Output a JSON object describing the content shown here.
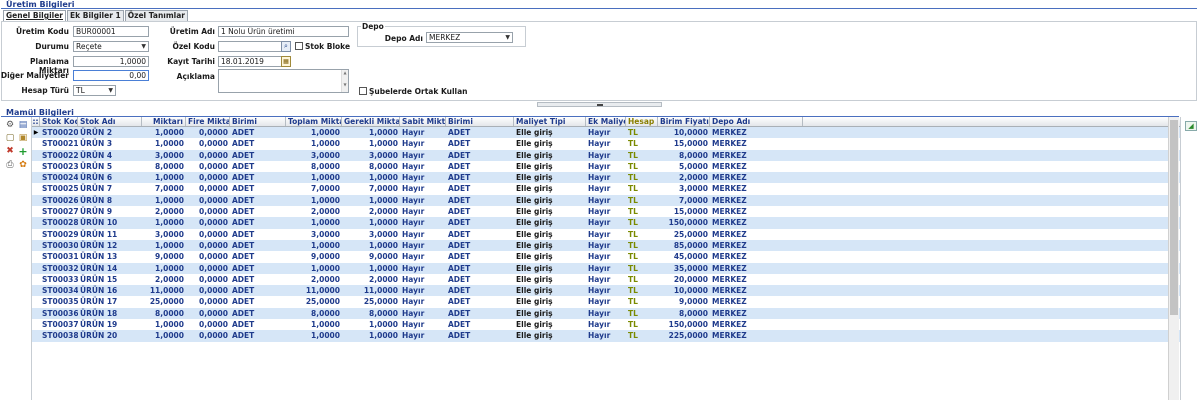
{
  "section_uretim": "Üretim Bilgileri",
  "tabs": [
    {
      "label": "Genel Bilgiler",
      "active": true
    },
    {
      "label": "Ek Bilgiler 1",
      "active": false
    },
    {
      "label": "Özel Tanımlar",
      "active": false
    }
  ],
  "form": {
    "uretim_kodu_label": "Üretim Kodu",
    "uretim_kodu": "BUR00001",
    "durumu_label": "Durumu",
    "durumu": "Reçete",
    "planlama_label": "Planlama Miktarı",
    "planlama": "1,0000",
    "diger_label": "Diğer Maliyetler",
    "diger": "0,00",
    "hesap_turu_label": "Hesap Türü",
    "hesap_turu": "TL",
    "uretim_adi_label": "Üretim Adı",
    "uretim_adi": "1 Nolu Ürün üretimi",
    "ozel_kodu_label": "Özel Kodu",
    "ozel_kodu": "",
    "stok_bloke_label": "Stok Bloke",
    "kayit_tarihi_label": "Kayıt Tarihi",
    "kayit_tarihi": "18.01.2019",
    "aciklama_label": "Açıklama",
    "aciklama": "",
    "depo_group_label": "Depo",
    "depo_adi_label": "Depo Adı",
    "depo_adi": "MERKEZ",
    "subeler_label": "Şubelerde Ortak Kullan"
  },
  "section_mamul": "Mamül Bilgileri",
  "grid": {
    "columns": [
      "Stok Kodu",
      "Stok Adı",
      "Miktarı",
      "Fire Miktarı",
      "Birimi",
      "Toplam Miktar",
      "Gerekli Miktar",
      "Sabit Miktar",
      "Birimi",
      "Maliyet Tipi",
      "Ek Maliyet",
      "Hesap",
      "Birim Fiyatı",
      "Depo Adı"
    ],
    "rows": [
      [
        "ST00020",
        "ÜRÜN 2",
        "1,0000",
        "0,0000",
        "ADET",
        "1,0000",
        "1,0000",
        "Hayır",
        "ADET",
        "Elle giriş",
        "Hayır",
        "TL",
        "10,0000",
        "MERKEZ"
      ],
      [
        "ST00021",
        "ÜRÜN 3",
        "1,0000",
        "0,0000",
        "ADET",
        "1,0000",
        "1,0000",
        "Hayır",
        "ADET",
        "Elle giriş",
        "Hayır",
        "TL",
        "15,0000",
        "MERKEZ"
      ],
      [
        "ST00022",
        "ÜRÜN 4",
        "3,0000",
        "0,0000",
        "ADET",
        "3,0000",
        "3,0000",
        "Hayır",
        "ADET",
        "Elle giriş",
        "Hayır",
        "TL",
        "8,0000",
        "MERKEZ"
      ],
      [
        "ST00023",
        "ÜRÜN 5",
        "8,0000",
        "0,0000",
        "ADET",
        "8,0000",
        "8,0000",
        "Hayır",
        "ADET",
        "Elle giriş",
        "Hayır",
        "TL",
        "5,0000",
        "MERKEZ"
      ],
      [
        "ST00024",
        "ÜRÜN 6",
        "1,0000",
        "0,0000",
        "ADET",
        "1,0000",
        "1,0000",
        "Hayır",
        "ADET",
        "Elle giriş",
        "Hayır",
        "TL",
        "2,0000",
        "MERKEZ"
      ],
      [
        "ST00025",
        "ÜRÜN 7",
        "7,0000",
        "0,0000",
        "ADET",
        "7,0000",
        "7,0000",
        "Hayır",
        "ADET",
        "Elle giriş",
        "Hayır",
        "TL",
        "3,0000",
        "MERKEZ"
      ],
      [
        "ST00026",
        "ÜRÜN 8",
        "1,0000",
        "0,0000",
        "ADET",
        "1,0000",
        "1,0000",
        "Hayır",
        "ADET",
        "Elle giriş",
        "Hayır",
        "TL",
        "7,0000",
        "MERKEZ"
      ],
      [
        "ST00027",
        "ÜRÜN 9",
        "2,0000",
        "0,0000",
        "ADET",
        "2,0000",
        "2,0000",
        "Hayır",
        "ADET",
        "Elle giriş",
        "Hayır",
        "TL",
        "15,0000",
        "MERKEZ"
      ],
      [
        "ST00028",
        "ÜRÜN 10",
        "1,0000",
        "0,0000",
        "ADET",
        "1,0000",
        "1,0000",
        "Hayır",
        "ADET",
        "Elle giriş",
        "Hayır",
        "TL",
        "150,0000",
        "MERKEZ"
      ],
      [
        "ST00029",
        "ÜRÜN 11",
        "3,0000",
        "0,0000",
        "ADET",
        "3,0000",
        "3,0000",
        "Hayır",
        "ADET",
        "Elle giriş",
        "Hayır",
        "TL",
        "25,0000",
        "MERKEZ"
      ],
      [
        "ST00030",
        "ÜRÜN 12",
        "1,0000",
        "0,0000",
        "ADET",
        "1,0000",
        "1,0000",
        "Hayır",
        "ADET",
        "Elle giriş",
        "Hayır",
        "TL",
        "85,0000",
        "MERKEZ"
      ],
      [
        "ST00031",
        "ÜRÜN 13",
        "9,0000",
        "0,0000",
        "ADET",
        "9,0000",
        "9,0000",
        "Hayır",
        "ADET",
        "Elle giriş",
        "Hayır",
        "TL",
        "45,0000",
        "MERKEZ"
      ],
      [
        "ST00032",
        "ÜRÜN 14",
        "1,0000",
        "0,0000",
        "ADET",
        "1,0000",
        "1,0000",
        "Hayır",
        "ADET",
        "Elle giriş",
        "Hayır",
        "TL",
        "35,0000",
        "MERKEZ"
      ],
      [
        "ST00033",
        "ÜRÜN 15",
        "2,0000",
        "0,0000",
        "ADET",
        "2,0000",
        "2,0000",
        "Hayır",
        "ADET",
        "Elle giriş",
        "Hayır",
        "TL",
        "20,0000",
        "MERKEZ"
      ],
      [
        "ST00034",
        "ÜRÜN 16",
        "11,0000",
        "0,0000",
        "ADET",
        "11,0000",
        "11,0000",
        "Hayır",
        "ADET",
        "Elle giriş",
        "Hayır",
        "TL",
        "10,0000",
        "MERKEZ"
      ],
      [
        "ST00035",
        "ÜRÜN 17",
        "25,0000",
        "0,0000",
        "ADET",
        "25,0000",
        "25,0000",
        "Hayır",
        "ADET",
        "Elle giriş",
        "Hayır",
        "TL",
        "9,0000",
        "MERKEZ"
      ],
      [
        "ST00036",
        "ÜRÜN 18",
        "8,0000",
        "0,0000",
        "ADET",
        "8,0000",
        "8,0000",
        "Hayır",
        "ADET",
        "Elle giriş",
        "Hayır",
        "TL",
        "8,0000",
        "MERKEZ"
      ],
      [
        "ST00037",
        "ÜRÜN 19",
        "1,0000",
        "0,0000",
        "ADET",
        "1,0000",
        "1,0000",
        "Hayır",
        "ADET",
        "Elle giriş",
        "Hayır",
        "TL",
        "150,0000",
        "MERKEZ"
      ],
      [
        "ST00038",
        "ÜRÜN 20",
        "1,0000",
        "0,0000",
        "ADET",
        "1,0000",
        "1,0000",
        "Hayır",
        "ADET",
        "Elle giriş",
        "Hayır",
        "TL",
        "225,0000",
        "MERKEZ"
      ]
    ]
  },
  "colors": {
    "header_text": "#1f3b8c",
    "row_alt": "#d6e6f7",
    "currency_text": "#7a8a00"
  }
}
